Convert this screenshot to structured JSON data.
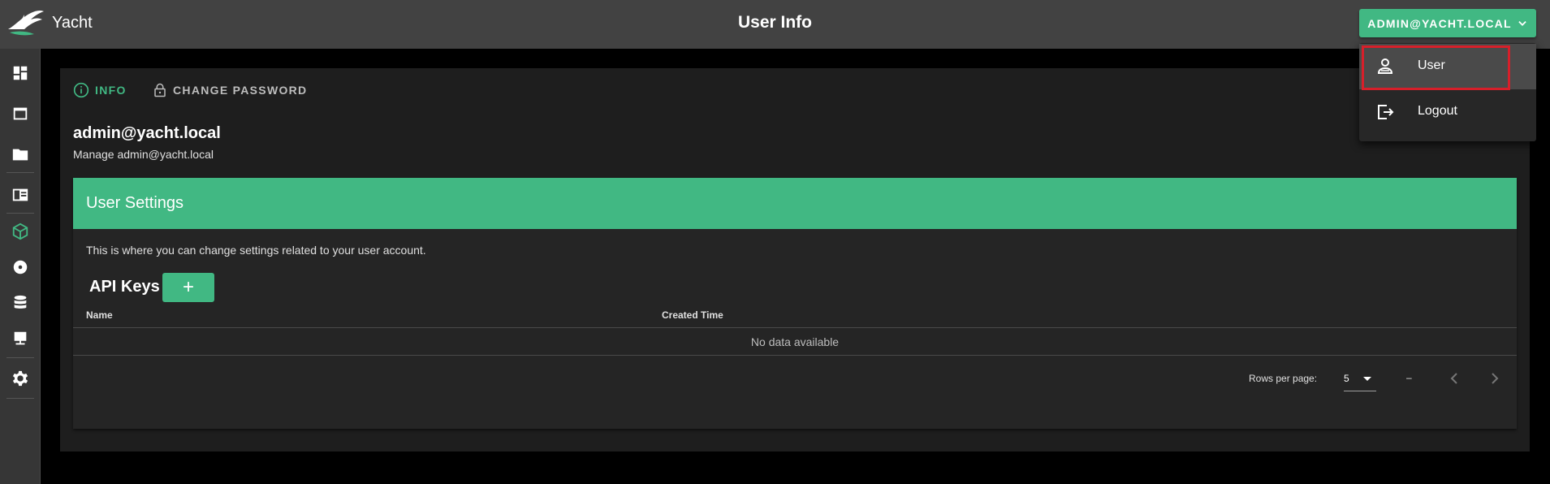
{
  "app": {
    "brand": "Yacht",
    "page_title": "User Info",
    "user_menu_label": "ADMIN@YACHT.LOCAL"
  },
  "sidebar": {
    "items": [
      {
        "icon": "dashboard-icon"
      },
      {
        "icon": "application-icon"
      },
      {
        "icon": "folder-icon"
      },
      {
        "icon": "template-icon"
      },
      {
        "icon": "cube-icon",
        "active": true
      },
      {
        "icon": "disc-icon"
      },
      {
        "icon": "database-icon"
      },
      {
        "icon": "server-icon"
      },
      {
        "icon": "gear-icon"
      }
    ]
  },
  "tabs": [
    {
      "label": "INFO",
      "icon": "info-icon",
      "active": true
    },
    {
      "label": "CHANGE PASSWORD",
      "icon": "lock-icon",
      "active": false
    }
  ],
  "user": {
    "email": "admin@yacht.local",
    "subtitle": "Manage admin@yacht.local"
  },
  "settings": {
    "title": "User Settings",
    "description": "This is where you can change settings related to your user account."
  },
  "api_keys": {
    "title": "API Keys",
    "add_label": "+",
    "columns": [
      "Name",
      "Created Time"
    ],
    "empty_text": "No data available",
    "rows_per_page_label": "Rows per page:",
    "rows_per_page_value": "5",
    "page_range": "–"
  },
  "dropdown": {
    "items": [
      {
        "label": "User",
        "icon": "user-icon"
      },
      {
        "label": "Logout",
        "icon": "logout-icon"
      }
    ]
  },
  "colors": {
    "accent": "#41b883",
    "topbar": "#424242",
    "highlight": "#d71f2a"
  }
}
